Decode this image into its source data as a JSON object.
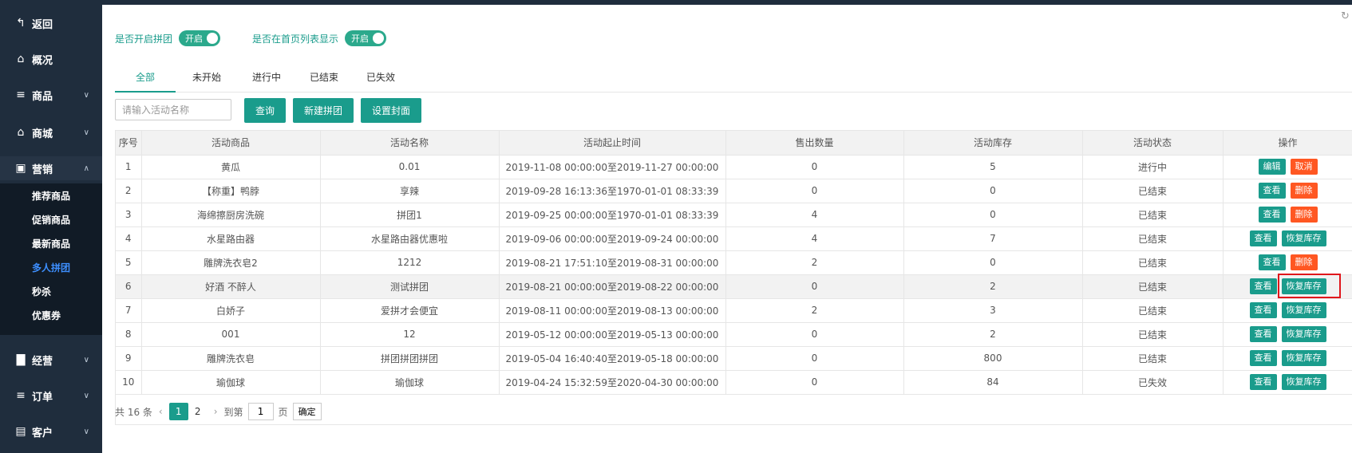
{
  "sidebar": {
    "items": [
      {
        "label": "返回",
        "icon": "back-icon"
      },
      {
        "label": "概况",
        "icon": "home-icon"
      },
      {
        "label": "商品",
        "icon": "list-icon"
      },
      {
        "label": "商城",
        "icon": "shop-icon"
      },
      {
        "label": "营销",
        "icon": "gift-icon"
      },
      {
        "label": "经营",
        "icon": "bar-chart-icon"
      },
      {
        "label": "订单",
        "icon": "list-icon"
      },
      {
        "label": "客户",
        "icon": "id-card-icon"
      }
    ],
    "submenu": [
      "推荐商品",
      "促销商品",
      "最新商品",
      "多人拼团",
      "秒杀",
      "优惠券"
    ],
    "active_sub": "多人拼团"
  },
  "toggles": [
    {
      "label": "是否开启拼团",
      "state": "开启"
    },
    {
      "label": "是否在首页列表显示",
      "state": "开启"
    }
  ],
  "tabs": [
    "全部",
    "未开始",
    "进行中",
    "已结束",
    "已失效"
  ],
  "active_tab": "全部",
  "search": {
    "placeholder": "请输入活动名称"
  },
  "buttons": {
    "query": "查询",
    "new_group": "新建拼团",
    "set_cover": "设置封面"
  },
  "table": {
    "headers": [
      "序号",
      "活动商品",
      "活动名称",
      "活动起止时间",
      "售出数量",
      "活动库存",
      "活动状态",
      "操作"
    ],
    "rows": [
      {
        "no": "1",
        "product": "黄瓜",
        "name": "0.01",
        "time": "2019-11-08 00:00:00至2019-11-27 00:00:00",
        "sold": "0",
        "stock": "5",
        "status": "进行中",
        "ops": [
          {
            "label": "编辑",
            "kind": "teal"
          },
          {
            "label": "取消",
            "kind": "red"
          }
        ]
      },
      {
        "no": "2",
        "product": "【称重】鸭脖",
        "name": "享辣",
        "time": "2019-09-28 16:13:36至1970-01-01 08:33:39",
        "sold": "0",
        "stock": "0",
        "status": "已结束",
        "ops": [
          {
            "label": "查看",
            "kind": "teal"
          },
          {
            "label": "删除",
            "kind": "red"
          }
        ]
      },
      {
        "no": "3",
        "product": "海绵擦厨房洗碗",
        "name": "拼团1",
        "time": "2019-09-25 00:00:00至1970-01-01 08:33:39",
        "sold": "4",
        "stock": "0",
        "status": "已结束",
        "ops": [
          {
            "label": "查看",
            "kind": "teal"
          },
          {
            "label": "删除",
            "kind": "red"
          }
        ]
      },
      {
        "no": "4",
        "product": "水星路由器",
        "name": "水星路由器优惠啦",
        "time": "2019-09-06 00:00:00至2019-09-24 00:00:00",
        "sold": "4",
        "stock": "7",
        "status": "已结束",
        "ops": [
          {
            "label": "查看",
            "kind": "teal"
          },
          {
            "label": "恢复库存",
            "kind": "teal"
          }
        ]
      },
      {
        "no": "5",
        "product": "雕牌洗衣皂2",
        "name": "1212",
        "time": "2019-08-21 17:51:10至2019-08-31 00:00:00",
        "sold": "2",
        "stock": "0",
        "status": "已结束",
        "ops": [
          {
            "label": "查看",
            "kind": "teal"
          },
          {
            "label": "删除",
            "kind": "red"
          }
        ]
      },
      {
        "no": "6",
        "product": "好酒 不醉人",
        "name": "测试拼团",
        "time": "2019-08-21 00:00:00至2019-08-22 00:00:00",
        "sold": "0",
        "stock": "2",
        "status": "已结束",
        "ops": [
          {
            "label": "查看",
            "kind": "teal"
          },
          {
            "label": "恢复库存",
            "kind": "teal"
          }
        ]
      },
      {
        "no": "7",
        "product": "白娇子",
        "name": "爱拼才会便宜",
        "time": "2019-08-11 00:00:00至2019-08-13 00:00:00",
        "sold": "2",
        "stock": "3",
        "status": "已结束",
        "ops": [
          {
            "label": "查看",
            "kind": "teal"
          },
          {
            "label": "恢复库存",
            "kind": "teal"
          }
        ]
      },
      {
        "no": "8",
        "product": "001",
        "name": "12",
        "time": "2019-05-12 00:00:00至2019-05-13 00:00:00",
        "sold": "0",
        "stock": "2",
        "status": "已结束",
        "ops": [
          {
            "label": "查看",
            "kind": "teal"
          },
          {
            "label": "恢复库存",
            "kind": "teal"
          }
        ]
      },
      {
        "no": "9",
        "product": "雕牌洗衣皂",
        "name": "拼团拼团拼团",
        "time": "2019-05-04 16:40:40至2019-05-18 00:00:00",
        "sold": "0",
        "stock": "800",
        "status": "已结束",
        "ops": [
          {
            "label": "查看",
            "kind": "teal"
          },
          {
            "label": "恢复库存",
            "kind": "teal"
          }
        ]
      },
      {
        "no": "10",
        "product": "瑜伽球",
        "name": "瑜伽球",
        "time": "2019-04-24 15:32:59至2020-04-30 00:00:00",
        "sold": "0",
        "stock": "84",
        "status": "已失效",
        "ops": [
          {
            "label": "查看",
            "kind": "teal"
          },
          {
            "label": "恢复库存",
            "kind": "teal"
          }
        ]
      }
    ]
  },
  "pager": {
    "total": "共 16 条",
    "pages": [
      "1",
      "2"
    ],
    "current": "1",
    "goto_label": "到第",
    "goto_value": "1",
    "page_unit": "页",
    "confirm": "确定"
  }
}
